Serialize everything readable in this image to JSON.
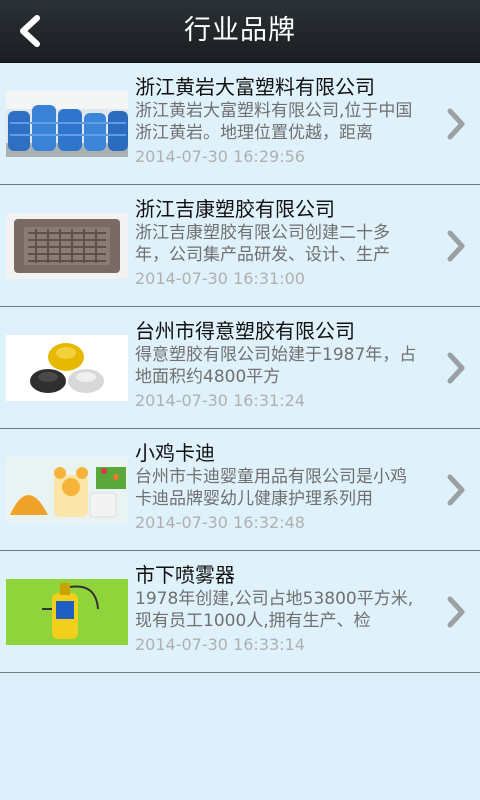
{
  "header": {
    "title": "行业品牌",
    "back_icon": "back-arrow-icon"
  },
  "items": [
    {
      "title": "浙江黄岩大富塑料有限公司",
      "desc": "浙江黄岩大富塑料有限公司,位于中国浙江黄岩。地理位置优越，距离",
      "time": "2014-07-30 16:29:56",
      "image": "blue-water-tanks"
    },
    {
      "title": "浙江吉康塑胶有限公司",
      "desc": "浙江吉康塑胶有限公司创建二十多年，公司集产品研发、设计、生产",
      "time": "2014-07-30 16:31:00",
      "image": "plastic-grate-tray"
    },
    {
      "title": "台州市得意塑胶有限公司",
      "desc": "得意塑胶有限公司始建于1987年，占地面积约4800平方",
      "time": "2014-07-30 16:31:24",
      "image": "plastic-lids"
    },
    {
      "title": "小鸡卡迪",
      "desc": "台州市卡迪婴童用品有限公司是小鸡卡迪品牌婴幼儿健康护理系列用",
      "time": "2014-07-30 16:32:48",
      "image": "baby-products"
    },
    {
      "title": "市下喷雾器",
      "desc": "1978年创建,公司占地53800平方米,现有员工1000人,拥有生产、检",
      "time": "2014-07-30 16:33:14",
      "image": "yellow-sprayer"
    }
  ]
}
